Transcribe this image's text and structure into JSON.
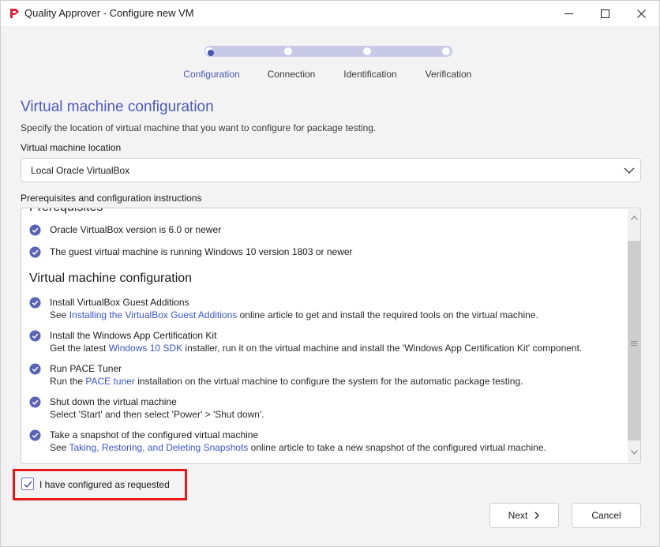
{
  "window": {
    "title": "Quality Approver - Configure new VM"
  },
  "stepper": {
    "steps": [
      {
        "label": "Configuration",
        "active": true
      },
      {
        "label": "Connection",
        "active": false
      },
      {
        "label": "Identification",
        "active": false
      },
      {
        "label": "Verification",
        "active": false
      }
    ]
  },
  "page": {
    "heading": "Virtual machine configuration",
    "subtext": "Specify the location of virtual machine that you want to configure for package testing.",
    "location_label": "Virtual machine location",
    "location_value": "Local Oracle VirtualBox",
    "instructions_label": "Prerequisites and configuration instructions"
  },
  "instructions": {
    "prereq_heading": "Prerequisites",
    "prereqs": [
      "Oracle VirtualBox version is 6.0 or newer",
      "The guest virtual machine is running Windows 10 version 1803 or newer"
    ],
    "config_heading": "Virtual machine configuration",
    "steps": [
      {
        "title": "Install VirtualBox Guest Additions",
        "desc_pre": "See ",
        "link": "Installing the VirtualBox Guest Additions",
        "desc_post": " online article to get and install the required tools on the virtual machine."
      },
      {
        "title": "Install the Windows App Certification Kit",
        "desc_pre": "Get the latest ",
        "link": "Windows 10 SDK",
        "desc_post": " installer, run it on the virtual machine and install the 'Windows App Certification Kit' component."
      },
      {
        "title": "Run PACE Tuner",
        "desc_pre": "Run the ",
        "link": "PACE tuner",
        "desc_post": " installation on the virtual machine to configure the system for the automatic package testing."
      },
      {
        "title": "Shut down the virtual machine",
        "desc_pre": "Select 'Start' and then select 'Power' > 'Shut down'.",
        "link": "",
        "desc_post": ""
      },
      {
        "title": "Take a snapshot of the configured virtual machine",
        "desc_pre": "See ",
        "link": "Taking, Restoring, and Deleting Snapshots",
        "desc_post": " online article to take a new snapshot of the configured virtual machine."
      }
    ]
  },
  "confirm": {
    "label": "I have configured as requested",
    "checked": true
  },
  "footer": {
    "next_label": "Next",
    "cancel_label": "Cancel"
  },
  "colors": {
    "accent": "#5059b8",
    "check": "#5a64b6",
    "link": "#3b55c7",
    "highlight": "#e41a1a"
  }
}
